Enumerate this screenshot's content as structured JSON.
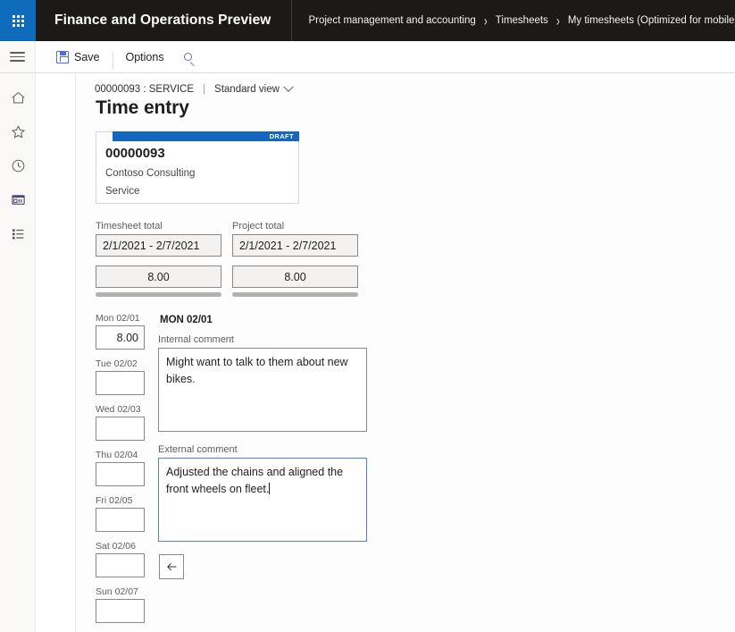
{
  "header": {
    "app_launcher_icon": "waffle-icon",
    "app_title": "Finance and Operations Preview",
    "breadcrumb": [
      "Project management and accounting",
      "Timesheets",
      "My timesheets (Optimized for mobile)"
    ],
    "breadcrumb_separator": "›",
    "accent_color": "#0f6cbd",
    "background_color": "#1b1a19"
  },
  "commandbar": {
    "menu_icon": "hamburger-icon",
    "save_label": "Save",
    "save_icon": "floppy-disk-icon",
    "options_label": "Options",
    "search_icon": "search-icon"
  },
  "navrail": {
    "items": [
      {
        "icon": "home-icon",
        "name": "home"
      },
      {
        "icon": "star-icon",
        "name": "favorites"
      },
      {
        "icon": "clock-icon",
        "name": "recent"
      },
      {
        "icon": "workspace-icon",
        "name": "workspaces"
      },
      {
        "icon": "list-icon",
        "name": "modules"
      }
    ]
  },
  "page": {
    "caption_id": "00000093 : SERVICE",
    "caption_pipe": "|",
    "view_name": "Standard view",
    "title": "Time entry"
  },
  "record_card": {
    "status_badge": "DRAFT",
    "badge_color": "#1566c0",
    "number": "00000093",
    "customer": "Contoso Consulting",
    "category": "Service"
  },
  "totals": [
    {
      "label": "Timesheet total",
      "period": "2/1/2021 - 2/7/2021",
      "amount": "8.00"
    },
    {
      "label": "Project total",
      "period": "2/1/2021 - 2/7/2021",
      "amount": "8.00"
    }
  ],
  "days": [
    {
      "label": "Mon 02/01",
      "hours": "8.00"
    },
    {
      "label": "Tue 02/02",
      "hours": ""
    },
    {
      "label": "Wed 02/03",
      "hours": ""
    },
    {
      "label": "Thu 02/04",
      "hours": ""
    },
    {
      "label": "Fri 02/05",
      "hours": ""
    },
    {
      "label": "Sat 02/06",
      "hours": ""
    },
    {
      "label": "Sun 02/07",
      "hours": ""
    }
  ],
  "detail": {
    "day_heading": "MON 02/01",
    "internal_comment_label": "Internal comment",
    "internal_comment_value": "Might want to talk to them about new bikes.",
    "external_comment_label": "External comment",
    "external_comment_value": "Adjusted the chains and aligned the front wheels on fleet.",
    "external_comment_focused": true,
    "focus_border_color": "#4f83cf",
    "back_icon": "arrow-left-icon"
  }
}
